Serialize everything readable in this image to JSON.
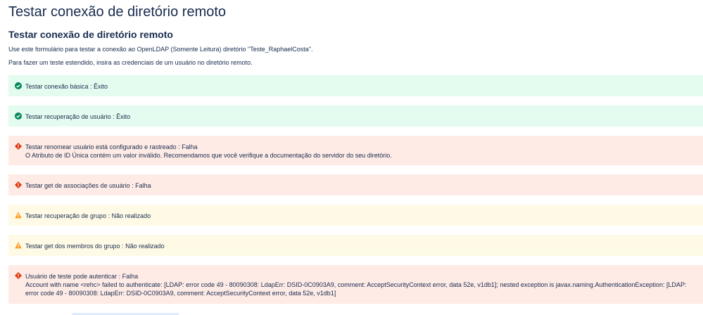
{
  "page": {
    "title": "Testar conexão de diretório remoto",
    "section_title": "Testar conexão de diretório remoto",
    "description_1": "Use este formulário para testar a conexão ao OpenLDAP (Somente Leitura) diretório \"Teste_RaphaelCosta\".",
    "description_2": "Para fazer um teste estendido, insira as credenciais de um usuário no diretório remoto."
  },
  "results": [
    {
      "status": "success",
      "icon": "check-circle-icon",
      "text": "Testar conexão básica : Êxito"
    },
    {
      "status": "success",
      "icon": "check-circle-icon",
      "text": "Testar recuperação de usuário : Êxito"
    },
    {
      "status": "error",
      "icon": "error-icon",
      "text": "Testar renomear usuário está configurado e rastreado : Falha",
      "detail": "O Atributo de ID Única contém um valor inválido. Recomendamos que você verifique a documentação do servidor do seu diretório."
    },
    {
      "status": "error",
      "icon": "error-icon",
      "text": "Testar get de associações de usuário : Falha"
    },
    {
      "status": "warning",
      "icon": "warning-icon",
      "text": "Testar recuperação de grupo : Não realizado"
    },
    {
      "status": "warning",
      "icon": "warning-icon",
      "text": "Testar get dos membros do grupo : Não realizado"
    },
    {
      "status": "error",
      "icon": "error-icon",
      "text": "Usuário de teste pode autenticar : Falha",
      "detail": "Account with name <rehc> failed to authenticate: [LDAP: error code 49 - 80090308: LdapErr: DSID-0C0903A9, comment: AcceptSecurityContext error, data 52e, v1db1]; nested exception is javax.naming.AuthenticationException: [LDAP: error code 49 - 80090308: LdapErr: DSID-0C0903A9, comment: AcceptSecurityContext error, data 52e, v1db1]"
    }
  ],
  "colors": {
    "success_bg": "#e3fcef",
    "success_icon": "#00875a",
    "error_bg": "#ffebe6",
    "error_icon": "#de350b",
    "warning_bg": "#fffae6",
    "warning_icon": "#ff991f"
  }
}
